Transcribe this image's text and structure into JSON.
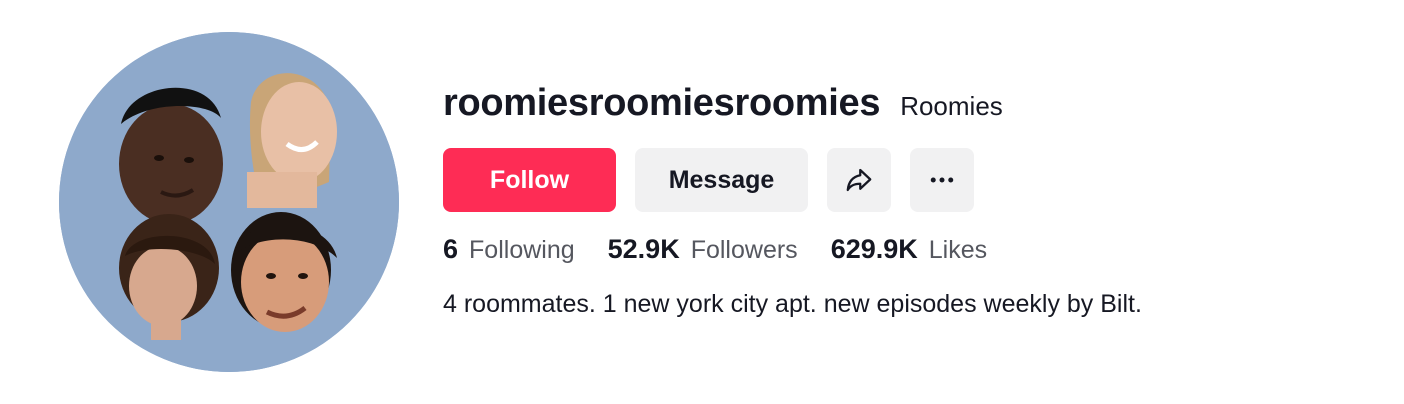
{
  "profile": {
    "username": "roomiesroomiesroomies",
    "nickname": "Roomies",
    "bio": "4 roommates. 1 new york city apt. new episodes weekly by Bilt."
  },
  "actions": {
    "follow_label": "Follow",
    "message_label": "Message",
    "share_icon": "share-icon",
    "more_icon": "more-icon"
  },
  "stats": {
    "following_count": "6",
    "following_label": "Following",
    "followers_count": "52.9K",
    "followers_label": "Followers",
    "likes_count": "629.9K",
    "likes_label": "Likes"
  },
  "colors": {
    "follow_button": "#fe2c55",
    "secondary_button": "#f1f1f2",
    "avatar_background": "#8ea9cb"
  }
}
